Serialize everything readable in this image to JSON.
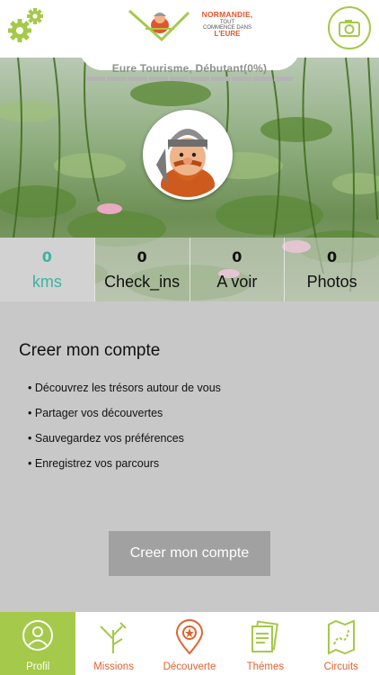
{
  "header": {
    "settings_icon": "gears-icon",
    "camera_icon": "camera-icon",
    "logo": {
      "line1": "NORMANDIE,",
      "line2": "TOUT",
      "line3": "COMMENCE DANS",
      "line4": "L'EURE"
    },
    "level_text": "Eure Tourisme, Débutant(0%)",
    "progress_fraction": 0.0
  },
  "stats": [
    {
      "value": "0",
      "label": "kms",
      "active": true
    },
    {
      "value": "0",
      "label": "Check_ins",
      "active": false
    },
    {
      "value": "0",
      "label": "A voir",
      "active": false
    },
    {
      "value": "0",
      "label": "Photos",
      "active": false
    }
  ],
  "content": {
    "title": "Creer mon compte",
    "benefits": [
      "Découvrez les trésors autour de vous",
      "Partager vos découvertes",
      "Sauvegardez vos préférences",
      "Enregistrez vos parcours"
    ],
    "button_label": "Creer mon compte"
  },
  "nav": [
    {
      "label": "Profil",
      "icon": "profile-icon",
      "active": true
    },
    {
      "label": "Missions",
      "icon": "missions-icon",
      "active": false
    },
    {
      "label": "Découverte",
      "icon": "location-pin-icon",
      "active": false
    },
    {
      "label": "Thémes",
      "icon": "themes-icon",
      "active": false
    },
    {
      "label": "Circuits",
      "icon": "map-icon",
      "active": false
    }
  ],
  "colors": {
    "accent_green": "#a5c94a",
    "teal": "#3bb4a2",
    "orange": "#e3622f",
    "gray_bg": "#c8c8c8"
  }
}
